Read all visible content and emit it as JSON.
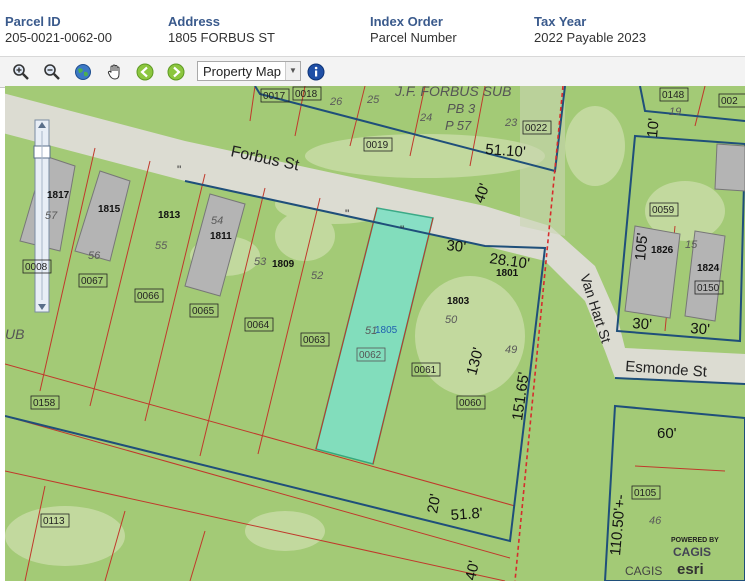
{
  "header": {
    "parcel_id_label": "Parcel ID",
    "parcel_id_value": "205-0021-0062-00",
    "address_label": "Address",
    "address_value": "1805 FORBUS ST",
    "index_order_label": "Index Order",
    "index_order_value": "Parcel Number",
    "tax_year_label": "Tax Year",
    "tax_year_value": "2022 Payable 2023"
  },
  "toolbar": {
    "map_type_selected": "Property Map",
    "icons": [
      "zoom-in-icon",
      "zoom-out-icon",
      "globe-icon",
      "pan-hand-icon",
      "back-arrow-icon",
      "forward-arrow-icon",
      "info-icon"
    ]
  },
  "map": {
    "streets": {
      "forbus": "Forbus St",
      "van_hart": "Van Hart St",
      "esmonde": "Esmonde St"
    },
    "subdivision": {
      "line1": "J.F. FORBUS SUB",
      "line2": "PB 3",
      "line3": "P 57",
      "sub_fragment": "UB"
    },
    "parcel_ids": {
      "p0017": "0017",
      "p0018": "0018",
      "p0019": "0019",
      "p0022": "0022",
      "p0148": "0148",
      "p0023": "002",
      "p0059": "0059",
      "p0150": "0150",
      "p0105": "0105",
      "p0158": "0158",
      "p0113": "0113",
      "p0008": "0008",
      "p0067": "0067",
      "p0066": "0066",
      "p0065": "0065",
      "p0064": "0064",
      "p0063": "0063",
      "p0062": "0062",
      "p0061": "0061",
      "p0060": "0060"
    },
    "lot_numbers": {
      "n26": "26",
      "n25": "25",
      "n24": "24",
      "n23": "23",
      "n19": "19",
      "n57": "57",
      "n56": "56",
      "n55": "55",
      "n54": "54",
      "n53": "53",
      "n52": "52",
      "n51": "51",
      "n50": "50",
      "n49": "49",
      "n46": "46",
      "n15": "15"
    },
    "house_numbers": {
      "h1817": "1817",
      "h1815": "1815",
      "h1813": "1813",
      "h1811": "1811",
      "h1809": "1809",
      "h1805": "1805",
      "h1803": "1803",
      "h1801": "1801",
      "h1826": "1826",
      "h1824": "1824"
    },
    "dimensions": {
      "d5110": "51.10'",
      "d40": "40'",
      "d30a": "30'",
      "d2810": "28.10'",
      "d130": "130'",
      "d15165": "151.65'",
      "d30b": "30'",
      "d30c": "30'",
      "d105": "105'",
      "d60": "60'",
      "d10": "10'",
      "d11050": "110.50'+-",
      "d20": "20'",
      "d518": "51.8'",
      "d40b": "40'"
    },
    "branding": {
      "powered_by": "POWERED BY",
      "cagis_logo": "CAGIS",
      "esri_logo": "esri",
      "cagis_text": "CAGIS"
    }
  }
}
